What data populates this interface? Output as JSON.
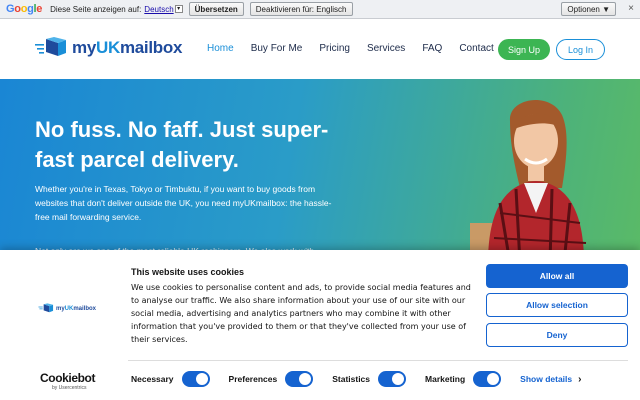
{
  "translate_bar": {
    "google": "Google",
    "text": "Diese Seite anzeigen auf:",
    "language": "Deutsch",
    "translate_button": "Übersetzen",
    "disable_button": "Deaktivieren für: Englisch",
    "options_button": "Optionen ▼",
    "close": "×"
  },
  "header": {
    "logo_prefix": "my",
    "logo_uk": "UK",
    "logo_suffix": "mailbox",
    "nav": [
      "Home",
      "Buy For Me",
      "Pricing",
      "Services",
      "FAQ",
      "Contact"
    ],
    "signup": "Sign Up",
    "login": "Log In"
  },
  "hero": {
    "title": "No fuss. No faff. Just super-fast parcel delivery.",
    "paragraph1": "Whether you're in Texas, Tokyo or Timbuktu, if you want to buy goods from websites that don't deliver outside the UK, you need myUKmailbox: the hassle-free mail forwarding service.",
    "paragraph2": "Not only are we one of the most reliable UK reshippers. We also work with"
  },
  "cookie": {
    "title": "This website uses cookies",
    "text": "We use cookies to personalise content and ads, to provide social media features and to analyse our traffic. We also share information about your use of our site with our social media, advertising and analytics partners who may combine it with other information that you've provided to them or that they've collected from your use of their services.",
    "allow_all": "Allow all",
    "allow_selection": "Allow selection",
    "deny": "Deny",
    "logo_prefix": "my",
    "logo_uk": "UK",
    "logo_suffix": "mailbox",
    "cookiebot": "Cookiebot",
    "cookiebot_by": "by Usercentrics",
    "toggles": [
      "Necessary",
      "Preferences",
      "Statistics",
      "Marketing"
    ],
    "show_details": "Show details",
    "chevron": "›"
  },
  "colors": {
    "brand_blue": "#1a8fd8",
    "brand_dark": "#1f4b9c",
    "green": "#3cb553",
    "cookie_blue": "#1563d0"
  }
}
